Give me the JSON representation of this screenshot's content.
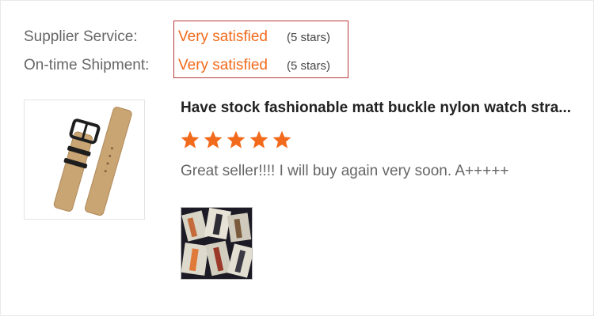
{
  "ratings": {
    "supplier_service_label": "Supplier Service:",
    "supplier_service_value": "Very satisfied",
    "supplier_service_stars": "(5 stars)",
    "shipment_label": "On-time Shipment:",
    "shipment_value": "Very satisfied",
    "shipment_stars": "(5 stars)"
  },
  "review": {
    "product_title": "Have stock fashionable matt buckle nylon watch stra...",
    "rating": 5,
    "rating_max": 5,
    "comment": "Great seller!!!! I will buy again very soon. A+++++",
    "star_color": "#f26a1b"
  },
  "colors": {
    "accent": "#f26a1b",
    "highlight_border": "#b83a3a",
    "label_text": "#666666"
  }
}
